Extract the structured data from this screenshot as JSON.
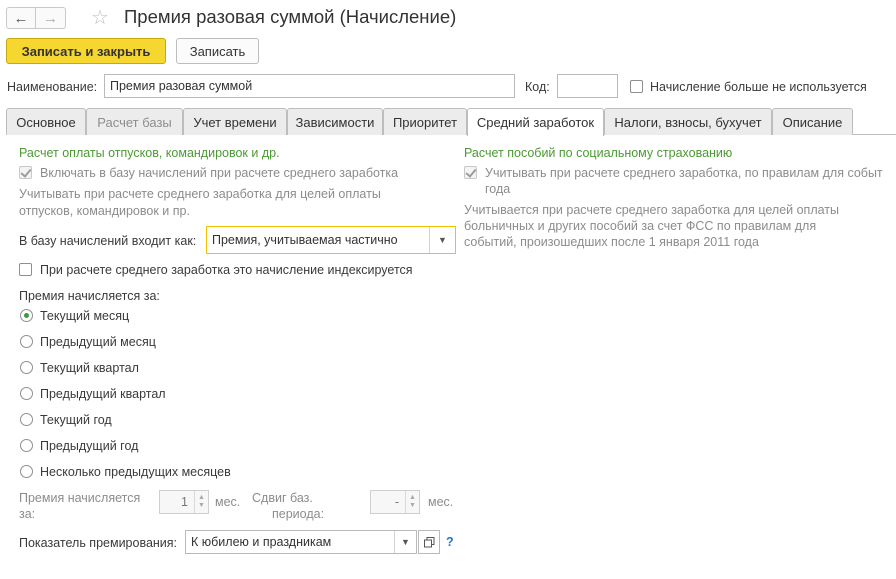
{
  "header": {
    "title": "Премия разовая суммой (Начисление)",
    "back_icon": "←",
    "forward_icon": "→",
    "star_icon": "☆"
  },
  "toolbar": {
    "save_close_label": "Записать и закрыть",
    "save_label": "Записать"
  },
  "form": {
    "name_label": "Наименование:",
    "name_value": "Премия разовая суммой",
    "code_label": "Код:",
    "code_value": "",
    "not_used_label": "Начисление больше не используется"
  },
  "tabs": [
    {
      "label": "Основное"
    },
    {
      "label": "Расчет базы"
    },
    {
      "label": "Учет времени"
    },
    {
      "label": "Зависимости"
    },
    {
      "label": "Приоритет"
    },
    {
      "label": "Средний заработок"
    },
    {
      "label": "Налоги, взносы, бухучет"
    },
    {
      "label": "Описание"
    }
  ],
  "left": {
    "section_title": "Расчет оплаты отпусков, командировок и др.",
    "include_base_label": "Включать в базу начислений при расчете среднего заработка",
    "note_line1": "Учитывать при расчете среднего заработка для целей оплаты",
    "note_line2": "отпусков, командировок и пр.",
    "base_label": "В базу начислений входит как:",
    "base_value": "Премия, учитываемая частично",
    "indexed_label": "При расчете среднего заработка это начисление индексируется",
    "period_label": "Премия начисляется за:",
    "radios": [
      {
        "label": "Текущий месяц"
      },
      {
        "label": "Предыдущий месяц"
      },
      {
        "label": "Текущий квартал"
      },
      {
        "label": "Предыдущий квартал"
      },
      {
        "label": "Текущий год"
      },
      {
        "label": "Предыдущий год"
      },
      {
        "label": "Несколько предыдущих месяцев"
      }
    ],
    "months_label_line1": "Премия начисляется",
    "months_label_line2": "за:",
    "months_value": "1",
    "months_unit": "мес.",
    "shift_label_line1": "Сдвиг баз.",
    "shift_label_line2": "периода:",
    "shift_value": "-",
    "shift_unit": "мес.",
    "indicator_label": "Показатель премирования:",
    "indicator_value": "К юбилею и праздникам",
    "help_mark": "?"
  },
  "right": {
    "section_title": "Расчет пособий по социальному страхованию",
    "check_line1": "Учитывать при расчете среднего заработка, по правилам для событ",
    "check_line2": "года",
    "note_line1": "Учитывается при расчете среднего заработка для целей оплаты",
    "note_line2": "больничных и других пособий за счет ФСС по правилам для",
    "note_line3": "событий, произошедших после 1 января 2011 года"
  },
  "colors": {
    "primary_button": "#f6d72f",
    "section_title": "#4b9a34",
    "focus_border": "#f2c200"
  }
}
